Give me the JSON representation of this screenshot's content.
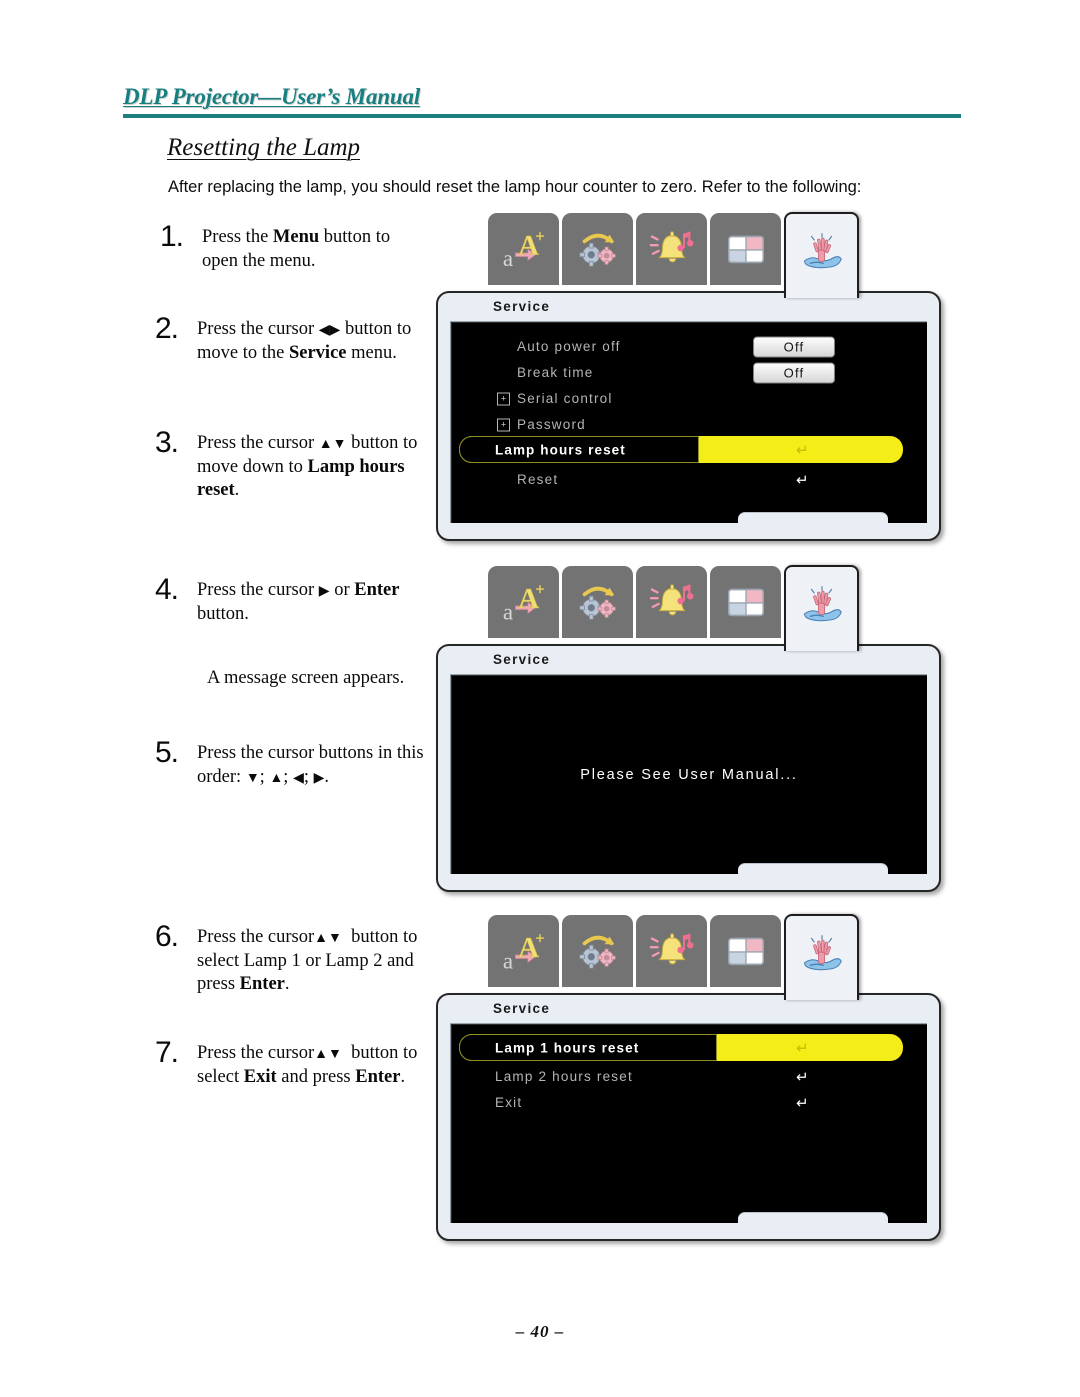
{
  "header": {
    "title": "DLP Projector—User’s Manual"
  },
  "section": {
    "heading": "Resetting the Lamp",
    "intro": "After replacing the lamp, you should reset the lamp hour counter to zero. Refer to the following:"
  },
  "steps": [
    {
      "num": "1.",
      "text_html": "Press the <b>Menu</b> button to open the menu."
    },
    {
      "num": "2.",
      "text_html": "Press the cursor <span class=\"arr\">◀▶</span> button to move to the <b>Service</b> menu."
    },
    {
      "num": "3.",
      "text_html": "Press the cursor <span class=\"arr\">▲▼</span> button to move down to <b>Lamp hours reset</b>."
    },
    {
      "num": "4.",
      "text_html": "Press the cursor <span class=\"arr\">▶</span> or <b>Enter</b> button."
    },
    {
      "num": "5.",
      "text_html": "Press the cursor buttons in this order: <span class=\"arr\">▼</span>; <span class=\"arr\">▲</span>; <span class=\"arr\">◀</span>; <span class=\"arr\">▶</span>."
    },
    {
      "num": "6.",
      "text_html": "Press the cursor<span class=\"arr\">▲▼</span>&nbsp; button to select Lamp 1 or Lamp 2 and press <b>Enter</b>."
    },
    {
      "num": "7.",
      "text_html": "Press the cursor<span class=\"arr\">▲▼</span>&nbsp; button to select <b>Exit</b> and press <b>Enter</b>."
    }
  ],
  "notes": {
    "message_appears": "A message screen appears."
  },
  "osd_tabs": [
    {
      "name": "language-icon",
      "label": "aA+"
    },
    {
      "name": "setup-gears-icon",
      "label": "Setup"
    },
    {
      "name": "audio-bell-icon",
      "label": "Audio"
    },
    {
      "name": "screen-layout-icon",
      "label": "Screen"
    },
    {
      "name": "service-hand-water-icon",
      "label": "Service",
      "selected": true
    }
  ],
  "osd_screens": [
    {
      "id": "service-menu",
      "title": "Service",
      "rows": [
        {
          "label": "Auto power off",
          "value": "Off",
          "control": "value",
          "plus": false
        },
        {
          "label": "Break time",
          "value": "Off",
          "control": "value",
          "plus": false
        },
        {
          "label": "Serial control",
          "control": "submenu",
          "plus": true
        },
        {
          "label": "Password",
          "control": "submenu",
          "plus": true
        },
        {
          "label": "Lamp hours reset",
          "control": "enter",
          "highlight": true
        },
        {
          "label": "Reset",
          "control": "enter",
          "plus": false
        }
      ]
    },
    {
      "id": "message-screen",
      "title": "Service",
      "message": "Please See User Manual...",
      "rows": []
    },
    {
      "id": "lamp-reset-menu",
      "title": "Service",
      "rows": [
        {
          "label": "Lamp 1 hours reset",
          "control": "enter",
          "highlight": true
        },
        {
          "label": "Lamp 2 hours reset",
          "control": "enter",
          "plus": false
        },
        {
          "label": "Exit",
          "control": "enter",
          "plus": false
        }
      ]
    }
  ],
  "footer": {
    "page_number": "– 40 –"
  },
  "colors": {
    "header_teal": "#177f7f",
    "highlight_yellow": "#f5ed17",
    "osd_bezel": "#e9eef4",
    "tab_gray": "#737373"
  }
}
